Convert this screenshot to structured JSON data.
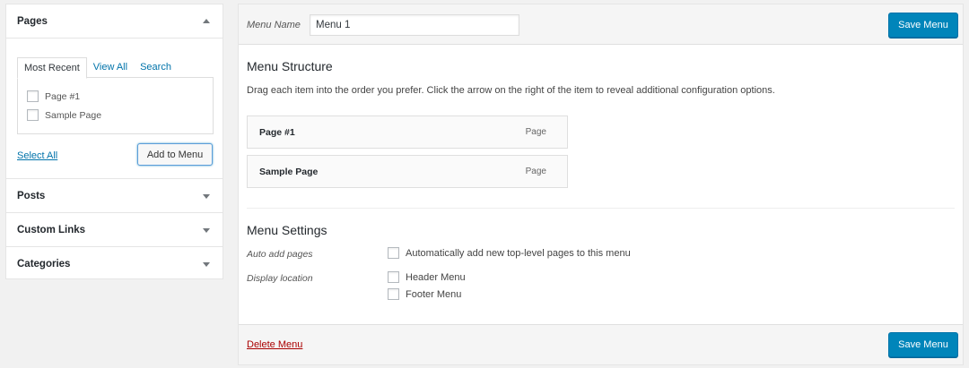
{
  "accordion": {
    "pages": {
      "title": "Pages",
      "tabs": [
        "Most Recent",
        "View All",
        "Search"
      ],
      "items": [
        "Page #1",
        "Sample Page"
      ],
      "select_all": "Select All",
      "add_button": "Add to Menu"
    },
    "sections": [
      "Posts",
      "Custom Links",
      "Categories"
    ]
  },
  "menu": {
    "name_label": "Menu Name",
    "name_value": "Menu 1",
    "save_label": "Save Menu",
    "structure_title": "Menu Structure",
    "instructions": "Drag each item into the order you prefer. Click the arrow on the right of the item to reveal additional configuration options.",
    "items": [
      {
        "title": "Page #1",
        "type": "Page"
      },
      {
        "title": "Sample Page",
        "type": "Page"
      }
    ],
    "settings_title": "Menu Settings",
    "auto_add_label": "Auto add pages",
    "auto_add_option": "Automatically add new top-level pages to this menu",
    "display_location_label": "Display location",
    "locations": [
      "Header Menu",
      "Footer Menu"
    ],
    "delete_label": "Delete Menu"
  },
  "colors": {
    "primary": "#0085ba",
    "link": "#0073aa",
    "delete": "#aa0000"
  },
  "icons": {
    "collapse": "triangle-up-icon",
    "expand": "triangle-down-icon"
  }
}
